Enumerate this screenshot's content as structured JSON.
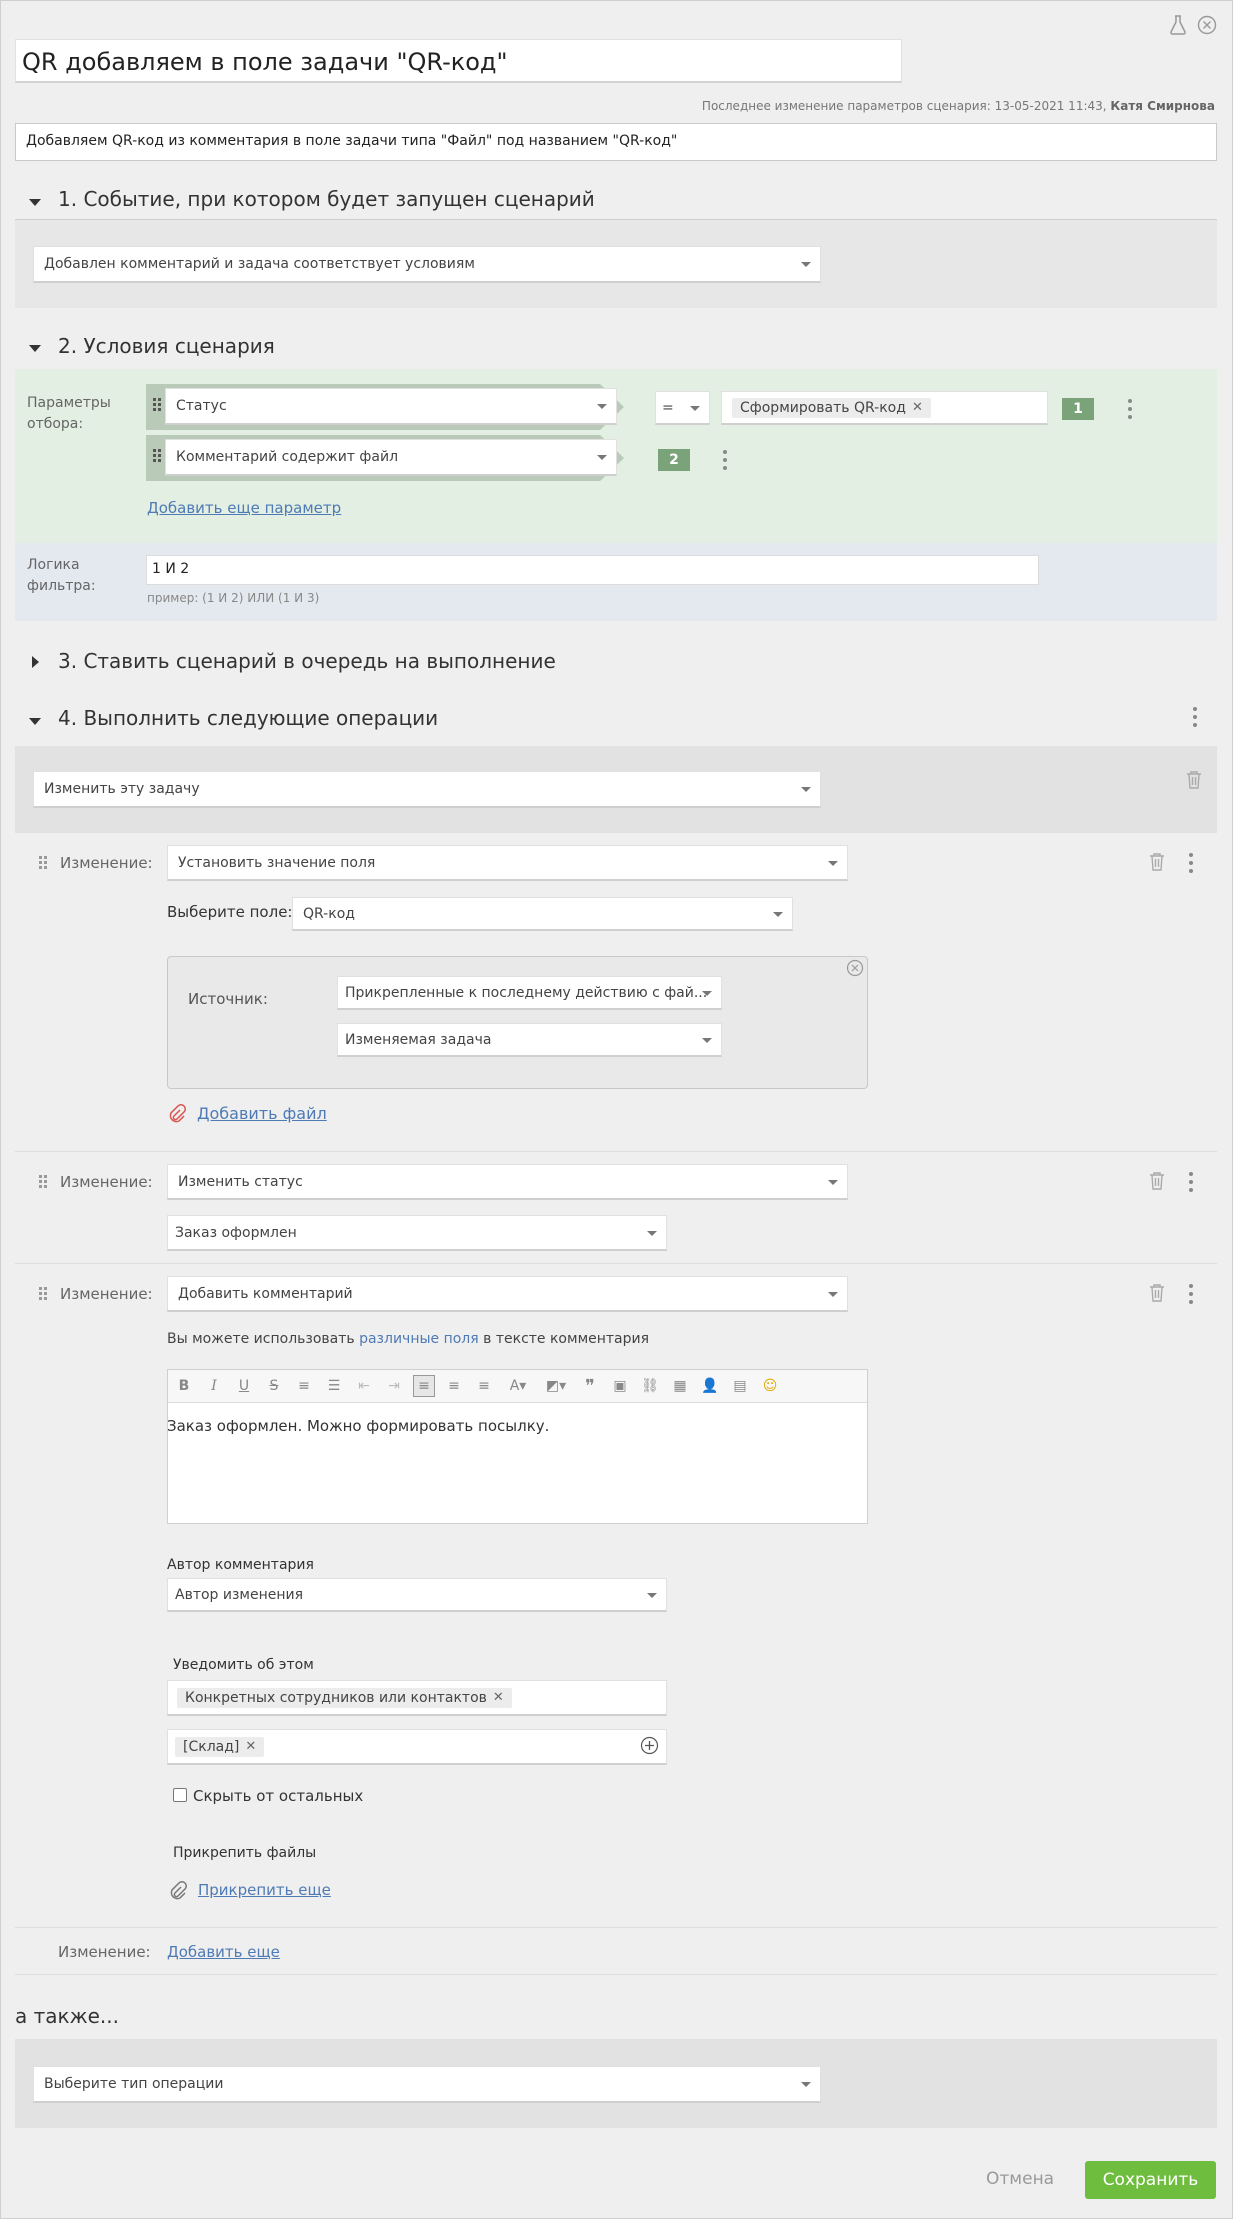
{
  "header": {
    "title": "QR добавляем в поле задачи \"QR-код\"",
    "last_modified_label": "Последнее изменение параметров сценария: 13-05-2021 11:43,",
    "last_modified_user": "Катя Смирнова",
    "description": "Добавляем QR-код из комментария в поле задачи типа \"Файл\" под названием \"QR-код\""
  },
  "section1": {
    "title": "1. Событие, при котором будет запущен сценарий",
    "event_value": "Добавлен комментарий и задача соответствует условиям"
  },
  "section2": {
    "title": "2. Условия сценария",
    "params_label": "Параметры отбора:",
    "conditions": [
      {
        "field": "Статус",
        "operator": "=",
        "value_tag": "Сформировать QR-код",
        "number": "1"
      },
      {
        "field": "Комментарий содержит файл",
        "number": "2"
      }
    ],
    "add_param_link": "Добавить еще параметр",
    "logic_label": "Логика фильтра:",
    "logic_value": "1 И 2",
    "logic_hint": "пример: (1 И 2) ИЛИ (1 И 3)"
  },
  "section3": {
    "title": "3. Ставить сценарий в очередь на выполнение"
  },
  "section4": {
    "title": "4. Выполнить следующие операции",
    "operation_target": "Изменить эту задачу",
    "change_label": "Изменение:",
    "change1": {
      "type": "Установить значение поля",
      "field_label": "Выберите поле:",
      "field_value": "QR-код",
      "source_label": "Источник:",
      "source_value": "Прикрепленные к последнему действию с фай...",
      "source_task": "Изменяемая задача",
      "add_file_link": "Добавить файл"
    },
    "change2": {
      "type": "Изменить статус",
      "status_value": "Заказ оформлен"
    },
    "change3": {
      "type": "Добавить комментарий",
      "hint_before": "Вы можете использовать ",
      "hint_link": "различные поля",
      "hint_after": " в тексте комментария",
      "comment_text": "Заказ оформлен. Можно формировать посылку.",
      "author_label": "Автор комментария",
      "author_value": "Автор изменения",
      "notify_label": "Уведомить об этом",
      "notify_tag": "Конкретных сотрудников или контактов",
      "recipient_tag": "[Склад]",
      "hide_label": "Скрыть от остальных",
      "attach_label": "Прикрепить файлы",
      "attach_link": "Прикрепить еще"
    },
    "add_more_label": "Изменение:",
    "add_more_link": "Добавить еще"
  },
  "also": {
    "title": "а также...",
    "select_placeholder": "Выберите тип операции"
  },
  "footer": {
    "cancel": "Отмена",
    "save": "Сохранить"
  },
  "colors": {
    "save_green": "#6ebd3e",
    "badge_green": "#7ba37a",
    "link_blue": "#4e7ab5",
    "conditions_bg": "#e2efe2",
    "logic_bg": "#e4e8ef"
  }
}
